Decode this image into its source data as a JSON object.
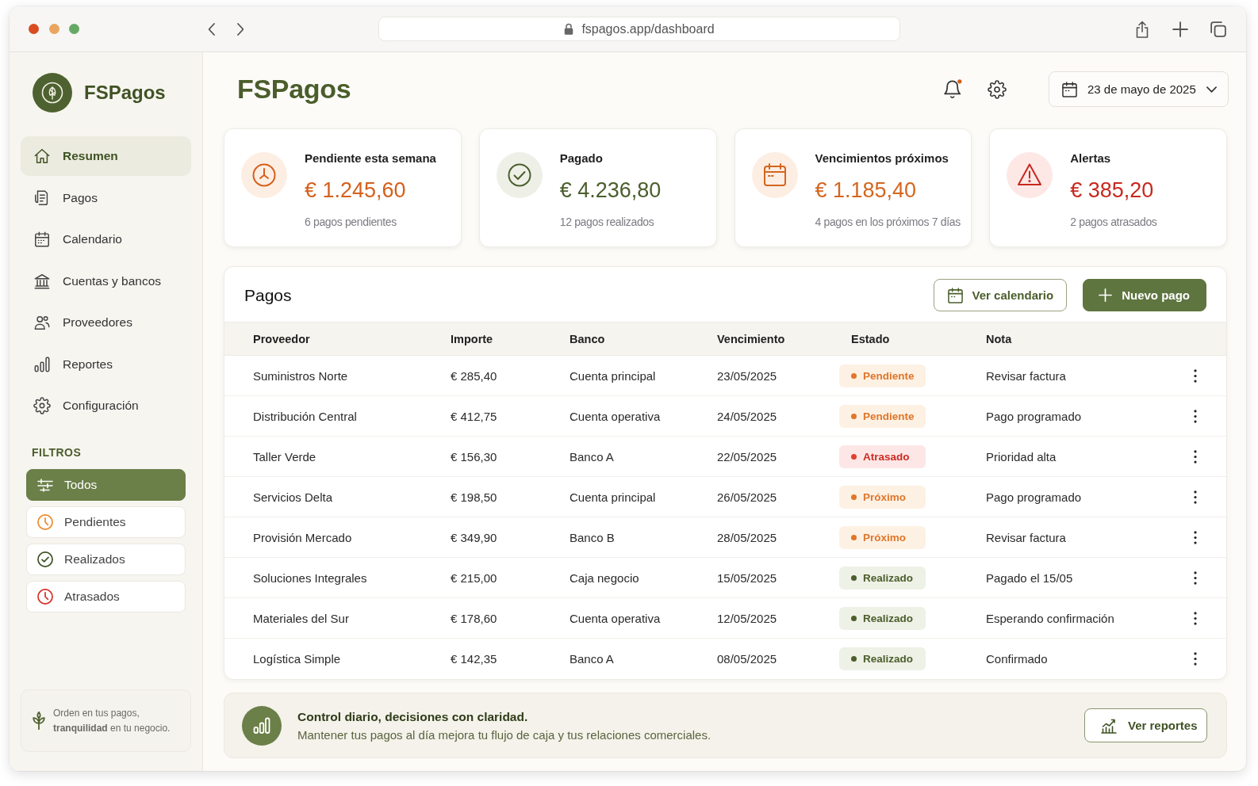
{
  "browser": {
    "url": "fspagos.app/dashboard"
  },
  "sidebar": {
    "brand": "FSPagos",
    "nav": [
      {
        "label": "Resumen",
        "selected": true
      },
      {
        "label": "Pagos",
        "selected": false
      },
      {
        "label": "Calendario",
        "selected": false
      },
      {
        "label": "Cuentas y bancos",
        "selected": false
      },
      {
        "label": "Proveedores",
        "selected": false
      },
      {
        "label": "Reportes",
        "selected": false
      },
      {
        "label": "Configuración",
        "selected": false
      }
    ],
    "filters_title": "FILTROS",
    "filters": [
      {
        "label": "Todos",
        "kind": "all",
        "selected": true
      },
      {
        "label": "Pendientes",
        "kind": "pending",
        "selected": false
      },
      {
        "label": "Realizados",
        "kind": "done",
        "selected": false
      },
      {
        "label": "Atrasados",
        "kind": "overdue",
        "selected": false
      }
    ],
    "tip": "Orden en tus pagos, **tranquilidad** en tu negocio."
  },
  "header": {
    "title": "FSPagos",
    "unread": true,
    "date": "23 de mayo de 2025"
  },
  "cards": [
    {
      "kind": "pending",
      "title": "Pendiente esta semana",
      "amount": "€ 1.245,60",
      "note": "6 pagos pendientes"
    },
    {
      "kind": "paid",
      "title": "Pagado",
      "amount": "€ 4.236,80",
      "note": "12 pagos realizados"
    },
    {
      "kind": "upcoming",
      "title": "Vencimientos próximos",
      "amount": "€ 1.185,40",
      "note": "4 pagos en los próximos 7 días"
    },
    {
      "kind": "alert",
      "title": "Alertas",
      "amount": "€ 385,20",
      "note": "2 pagos atrasados"
    }
  ],
  "payments": {
    "title": "Pagos",
    "actions": [
      {
        "label": "Ver calendario",
        "kind": "secondary"
      },
      {
        "label": "Nuevo pago",
        "kind": "primary"
      }
    ],
    "columns": [
      "Proveedor",
      "Importe",
      "Banco",
      "Vencimiento",
      "Estado",
      "Nota"
    ],
    "rows": [
      {
        "provider": "Suministros Norte",
        "amount": "€ 285,40",
        "bank": "Cuenta principal",
        "due": "23/05/2025",
        "status": {
          "label": "Pendiente",
          "kind": "pending"
        },
        "note": "Revisar factura"
      },
      {
        "provider": "Distribución Central",
        "amount": "€ 412,75",
        "bank": "Cuenta operativa",
        "due": "24/05/2025",
        "status": {
          "label": "Pendiente",
          "kind": "pending"
        },
        "note": "Pago programado"
      },
      {
        "provider": "Taller Verde",
        "amount": "€ 156,30",
        "bank": "Banco A",
        "due": "22/05/2025",
        "status": {
          "label": "Atrasado",
          "kind": "overdue"
        },
        "note": "Prioridad alta"
      },
      {
        "provider": "Servicios Delta",
        "amount": "€ 198,50",
        "bank": "Cuenta principal",
        "due": "26/05/2025",
        "status": {
          "label": "Próximo",
          "kind": "upcoming"
        },
        "note": "Pago programado"
      },
      {
        "provider": "Provisión Mercado",
        "amount": "€ 349,90",
        "bank": "Banco B",
        "due": "28/05/2025",
        "status": {
          "label": "Próximo",
          "kind": "upcoming"
        },
        "note": "Revisar factura"
      },
      {
        "provider": "Soluciones Integrales",
        "amount": "€ 215,00",
        "bank": "Caja negocio",
        "due": "15/05/2025",
        "status": {
          "label": "Realizado",
          "kind": "done"
        },
        "note": "Pagado el 15/05"
      },
      {
        "provider": "Materiales del Sur",
        "amount": "€ 178,60",
        "bank": "Cuenta operativa",
        "due": "12/05/2025",
        "status": {
          "label": "Realizado",
          "kind": "done"
        },
        "note": "Esperando confirmación"
      },
      {
        "provider": "Logística Simple",
        "amount": "€ 142,35",
        "bank": "Banco A",
        "due": "08/05/2025",
        "status": {
          "label": "Realizado",
          "kind": "done"
        },
        "note": "Confirmado"
      }
    ]
  },
  "banner": {
    "title": "Control diario, decisiones con claridad.",
    "text": "Mantener tus pagos al día mejora tu flujo de caja y tus relaciones comerciales.",
    "button": "Ver reportes"
  }
}
